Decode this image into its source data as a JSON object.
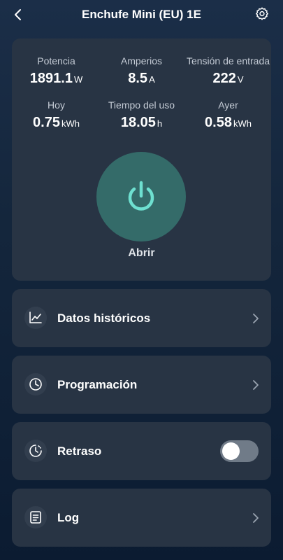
{
  "header": {
    "title": "Enchufe Mini (EU) 1E",
    "back_icon": "chevron-left-icon",
    "settings_icon": "gear-icon"
  },
  "stats": [
    {
      "label": "Potencia",
      "value": "1891.1",
      "unit": "W"
    },
    {
      "label": "Amperios",
      "value": "8.5",
      "unit": "A"
    },
    {
      "label": "Tensión de entrada",
      "value": "222",
      "unit": "V"
    },
    {
      "label": "Hoy",
      "value": "0.75",
      "unit": "kWh"
    },
    {
      "label": "Tiempo del uso",
      "value": "18.05",
      "unit": "h"
    },
    {
      "label": "Ayer",
      "value": "0.58",
      "unit": "kWh"
    }
  ],
  "power": {
    "label": "Abrir",
    "icon": "power-icon"
  },
  "menu": {
    "historical": {
      "label": "Datos históricos",
      "icon": "line-chart-icon"
    },
    "schedule": {
      "label": "Programación",
      "icon": "clock-icon"
    },
    "delay": {
      "label": "Retraso",
      "icon": "timer-icon",
      "enabled": false
    },
    "log": {
      "label": "Log",
      "icon": "document-icon"
    }
  },
  "colors": {
    "background": "#14263c",
    "card": "#283444",
    "power_button": "#346b69",
    "power_accent": "#6ee0d0",
    "toggle_off": "#707b88"
  }
}
